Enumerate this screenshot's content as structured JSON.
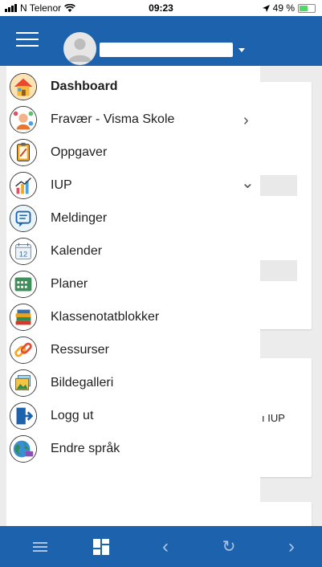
{
  "status_bar": {
    "carrier": "N Telenor",
    "time": "09:23",
    "battery": "49 %",
    "icons": [
      "signal-icon",
      "wifi-icon",
      "location-arrow-icon",
      "battery-icon"
    ]
  },
  "header": {
    "menu_icon": "hamburger-icon",
    "avatar_icon": "user-avatar-icon",
    "user_name": "",
    "dropdown_icon": "caret-down-icon",
    "background_color": "#1d62ad"
  },
  "menu": {
    "items": [
      {
        "label": "Dashboard",
        "icon": "house-icon"
      },
      {
        "label": "Fravær - Visma Skole",
        "icon": "attendance-icon",
        "chevron": "›"
      },
      {
        "label": "Oppgaver",
        "icon": "assignment-icon"
      },
      {
        "label": "IUP",
        "icon": "iup-chart-icon",
        "chevron": "⌄"
      },
      {
        "label": "Meldinger",
        "icon": "message-icon"
      },
      {
        "label": "Kalender",
        "icon": "calendar-icon",
        "icon_text": "12"
      },
      {
        "label": "Planer",
        "icon": "planner-icon"
      },
      {
        "label": "Klassenotatblokker",
        "icon": "books-icon"
      },
      {
        "label": "Ressurser",
        "icon": "link-icon"
      },
      {
        "label": "Bildegalleri",
        "icon": "gallery-icon"
      },
      {
        "label": "Logg ut",
        "icon": "logout-icon"
      },
      {
        "label": "Endre språk",
        "icon": "globe-icon"
      }
    ]
  },
  "background": {
    "partial_text": "ı IUP"
  },
  "bottom_bar": {
    "items": [
      {
        "icon": "menu-lines-icon",
        "glyph": "☰"
      },
      {
        "icon": "grid-icon",
        "glyph": ""
      },
      {
        "icon": "back-icon",
        "glyph": "‹"
      },
      {
        "icon": "refresh-icon",
        "glyph": "↻"
      },
      {
        "icon": "forward-icon",
        "glyph": "›"
      }
    ]
  }
}
